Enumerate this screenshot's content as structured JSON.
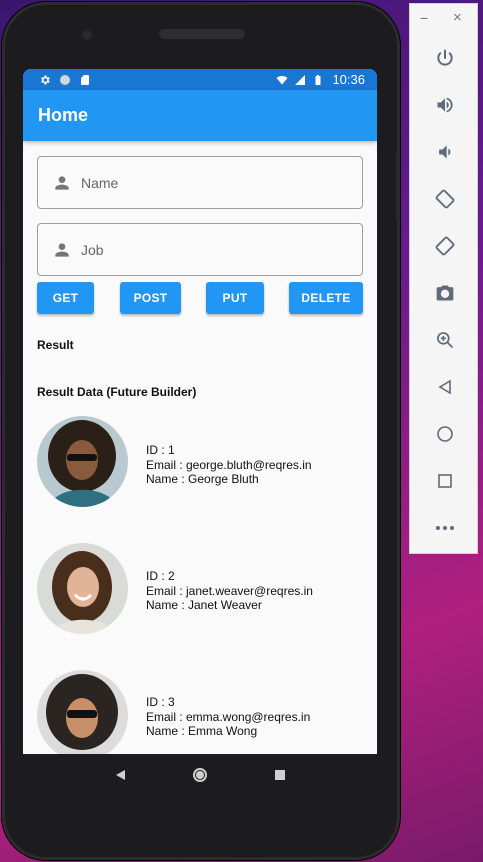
{
  "statusbar": {
    "time": "10:36"
  },
  "appbar": {
    "title": "Home"
  },
  "form": {
    "name_placeholder": "Name",
    "job_placeholder": "Job"
  },
  "buttons": {
    "get": "GET",
    "post": "POST",
    "put": "PUT",
    "delete": "DELETE"
  },
  "result": {
    "label": "Result"
  },
  "result_data": {
    "label": "Result Data (Future Builder)",
    "users": [
      {
        "id": "ID : 1",
        "email": "Email : george.bluth@reqres.in",
        "name": "Name : George Bluth"
      },
      {
        "id": "ID : 2",
        "email": "Email : janet.weaver@reqres.in",
        "name": "Name : Janet Weaver"
      },
      {
        "id": "ID : 3",
        "email": "Email : emma.wong@reqres.in",
        "name": "Name : Emma Wong"
      }
    ]
  },
  "emulator": {
    "minimize": "−",
    "close": "×",
    "controls": [
      "power-icon",
      "volume-up-icon",
      "volume-down-icon",
      "rotate-left-icon",
      "rotate-right-icon",
      "camera-icon",
      "zoom-icon",
      "back-icon",
      "home-icon",
      "overview-icon",
      "more-icon"
    ]
  },
  "colors": {
    "primary": "#2196f3",
    "statusbar": "#1976d2"
  }
}
